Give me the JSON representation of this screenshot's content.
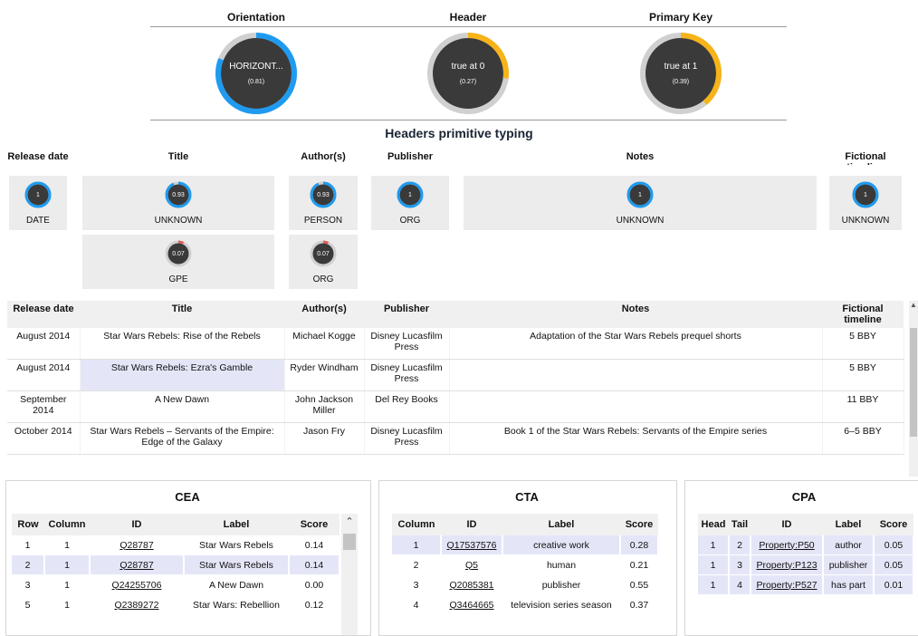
{
  "colors": {
    "gauge_blue": "#1e9bf0",
    "gauge_yellow": "#f7b318",
    "gauge_dark": "#3a3a3a",
    "ring_grey": "#d0d0d0",
    "highlight": "#e4e6f8",
    "mini_red": "#e06060"
  },
  "top_gauges": [
    {
      "title": "Orientation",
      "value": "HORIZONT...",
      "score": "(0.81)",
      "fraction": 0.81,
      "color": "blue"
    },
    {
      "title": "Header",
      "value": "true at 0",
      "score": "(0.27)",
      "fraction": 0.27,
      "color": "yellow"
    },
    {
      "title": "Primary Key",
      "value": "true at 1",
      "score": "(0.39)",
      "fraction": 0.39,
      "color": "yellow"
    }
  ],
  "headers_typing": {
    "title": "Headers primitive typing",
    "columns": [
      "Release date",
      "Title",
      "Author(s)",
      "Publisher",
      "Notes",
      "Fictional timeline"
    ],
    "cells": [
      {
        "col": 0,
        "row": 0,
        "score": "1",
        "label": "DATE",
        "fraction": 1.0
      },
      {
        "col": 1,
        "row": 0,
        "score": "0.93",
        "label": "UNKNOWN",
        "fraction": 0.93
      },
      {
        "col": 1,
        "row": 1,
        "score": "0.07",
        "label": "GPE",
        "fraction": 0.07
      },
      {
        "col": 2,
        "row": 0,
        "score": "0.93",
        "label": "PERSON",
        "fraction": 0.93
      },
      {
        "col": 2,
        "row": 1,
        "score": "0.07",
        "label": "ORG",
        "fraction": 0.07
      },
      {
        "col": 3,
        "row": 0,
        "score": "1",
        "label": "ORG",
        "fraction": 1.0
      },
      {
        "col": 4,
        "row": 0,
        "score": "1",
        "label": "UNKNOWN",
        "fraction": 1.0
      },
      {
        "col": 5,
        "row": 0,
        "score": "1",
        "label": "UNKNOWN",
        "fraction": 1.0
      }
    ]
  },
  "main_table": {
    "headers": [
      "Release date",
      "Title",
      "Author(s)",
      "Publisher",
      "Notes",
      "Fictional timeline"
    ],
    "rows": [
      [
        "August 2014",
        "Star Wars Rebels: Rise of the Rebels",
        "Michael Kogge",
        "Disney Lucasfilm Press",
        "Adaptation of the Star Wars Rebels prequel shorts",
        "5 BBY"
      ],
      [
        "August 2014",
        "Star Wars Rebels: Ezra's Gamble",
        "Ryder Windham",
        "Disney Lucasfilm Press",
        "",
        "5 BBY"
      ],
      [
        "September 2014",
        "A New Dawn",
        "John Jackson Miller",
        "Del Rey Books",
        "",
        "11 BBY"
      ],
      [
        "October 2014",
        "Star Wars Rebels – Servants of the Empire: Edge of the Galaxy",
        "Jason Fry",
        "Disney Lucasfilm Press",
        "Book 1 of the Star Wars Rebels: Servants of the Empire series",
        "6–5 BBY"
      ]
    ],
    "highlight": {
      "row": 1,
      "col": 1
    }
  },
  "cea": {
    "title": "CEA",
    "headers": [
      "Row",
      "Column",
      "ID",
      "Label",
      "Score"
    ],
    "rows": [
      [
        "1",
        "1",
        "Q28787",
        "Star Wars Rebels",
        "0.14"
      ],
      [
        "2",
        "1",
        "Q28787",
        "Star Wars Rebels",
        "0.14"
      ],
      [
        "3",
        "1",
        "Q24255706",
        "A New Dawn",
        "0.00"
      ],
      [
        "5",
        "1",
        "Q2389272",
        "Star Wars: Rebellion",
        "0.12"
      ]
    ],
    "highlight_row": 1
  },
  "cta": {
    "title": "CTA",
    "headers": [
      "Column",
      "ID",
      "Label",
      "Score"
    ],
    "rows": [
      [
        "1",
        "Q17537576",
        "creative work",
        "0.28"
      ],
      [
        "2",
        "Q5",
        "human",
        "0.21"
      ],
      [
        "3",
        "Q2085381",
        "publisher",
        "0.55"
      ],
      [
        "4",
        "Q3464665",
        "television series season",
        "0.37"
      ]
    ],
    "highlight_row": 0
  },
  "cpa": {
    "title": "CPA",
    "headers": [
      "Head",
      "Tail",
      "ID",
      "Label",
      "Score"
    ],
    "rows": [
      [
        "1",
        "2",
        "Property:P50",
        "author",
        "0.05"
      ],
      [
        "1",
        "3",
        "Property:P123",
        "publisher",
        "0.05"
      ],
      [
        "1",
        "4",
        "Property:P527",
        "has part",
        "0.01"
      ]
    ],
    "highlight_all": true
  },
  "icons": {
    "scroll_up": "chevron-up-icon"
  }
}
